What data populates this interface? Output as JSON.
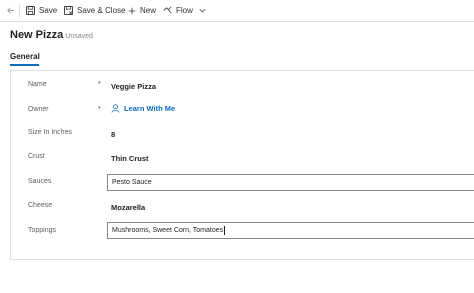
{
  "toolbar": {
    "save_label": "Save",
    "save_close_label": "Save & Close",
    "new_label": "New",
    "flow_label": "Flow"
  },
  "header": {
    "title": "New Pizza",
    "status": "- Unsaved"
  },
  "tabs": [
    {
      "label": "General",
      "selected": true
    }
  ],
  "form": {
    "name": {
      "label": "Name",
      "required": "*",
      "value": "Veggie Pizza"
    },
    "owner": {
      "label": "Owner",
      "required": "*",
      "value": "Learn With Me"
    },
    "size": {
      "label": "Size In Inches",
      "value": "8"
    },
    "crust": {
      "label": "Crust",
      "value": "Thin Crust"
    },
    "sauces": {
      "label": "Sauces",
      "value": "Pesto Sauce"
    },
    "cheese": {
      "label": "Cheese",
      "value": "Mozarella"
    },
    "toppings": {
      "label": "Toppings",
      "value": "Mushrooms, Sweet Corn, Tomatoes"
    }
  },
  "colors": {
    "accent": "#0f6cbd",
    "required": "#a4262c",
    "label": "#605e5c",
    "border": "#e1dfdd"
  }
}
